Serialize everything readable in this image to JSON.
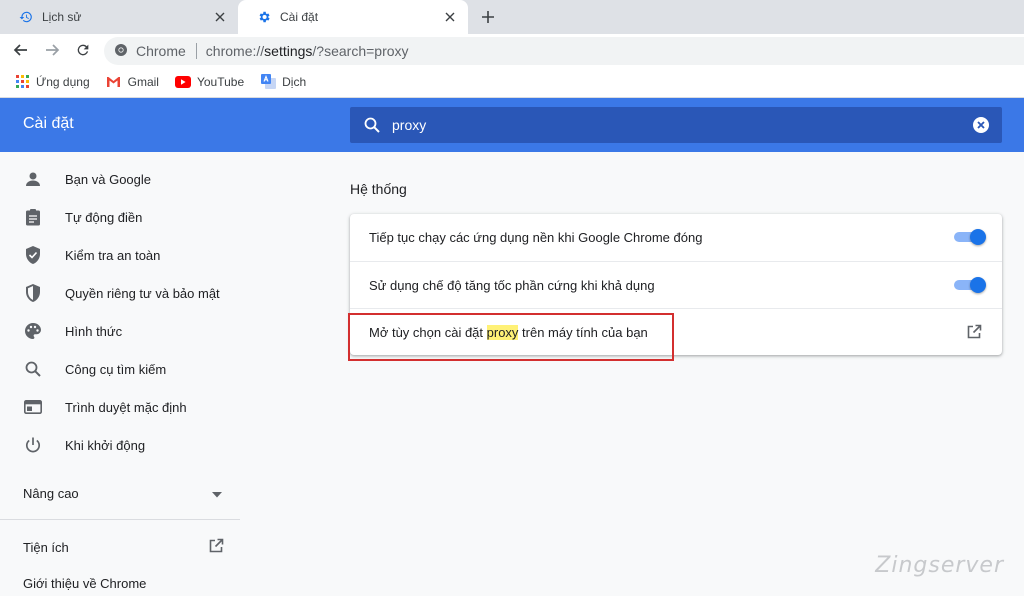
{
  "tabs": [
    {
      "label": "Lịch sử",
      "icon": "history-icon",
      "active": false
    },
    {
      "label": "Cài đặt",
      "icon": "gear-icon",
      "active": true
    }
  ],
  "toolbar": {
    "site_name": "Chrome",
    "url_prefix": "chrome://",
    "url_host": "settings",
    "url_rest": "/?search=proxy"
  },
  "bookmarks": [
    {
      "label": "Ứng dụng",
      "icon": "apps-grid-icon"
    },
    {
      "label": "Gmail",
      "icon": "gmail-icon"
    },
    {
      "label": "YouTube",
      "icon": "youtube-icon"
    },
    {
      "label": "Dịch",
      "icon": "translate-icon"
    }
  ],
  "header": {
    "title": "Cài đặt",
    "search_value": "proxy"
  },
  "sidebar": {
    "items": [
      {
        "label": "Bạn và Google",
        "icon": "person-icon"
      },
      {
        "label": "Tự động điền",
        "icon": "clipboard-icon"
      },
      {
        "label": "Kiểm tra an toàn",
        "icon": "shield-check-icon"
      },
      {
        "label": "Quyền riêng tư và bảo mật",
        "icon": "shield-icon"
      },
      {
        "label": "Hình thức",
        "icon": "palette-icon"
      },
      {
        "label": "Công cụ tìm kiếm",
        "icon": "search-icon"
      },
      {
        "label": "Trình duyệt mặc định",
        "icon": "browser-icon"
      },
      {
        "label": "Khi khởi động",
        "icon": "power-icon"
      }
    ],
    "advanced_label": "Nâng cao",
    "extensions_label": "Tiện ích",
    "about_label": "Giới thiệu về Chrome"
  },
  "main": {
    "section_title": "Hệ thống",
    "rows": [
      {
        "label": "Tiếp tục chạy các ứng dụng nền khi Google Chrome đóng",
        "toggle": true
      },
      {
        "label": "Sử dụng chế độ tăng tốc phần cứng khi khả dụng",
        "toggle": true
      }
    ],
    "proxy_row": {
      "before": "Mở tùy chọn cài đặt ",
      "highlight": "proxy",
      "after": " trên máy tính của bạn"
    }
  },
  "watermark": "Zingserver",
  "colors": {
    "header_blue": "#3b78e7",
    "search_blue": "#2a57b7",
    "toggle_blue": "#1a73e8",
    "highlight": "#fff176",
    "annotation_red": "#d32f2f"
  }
}
